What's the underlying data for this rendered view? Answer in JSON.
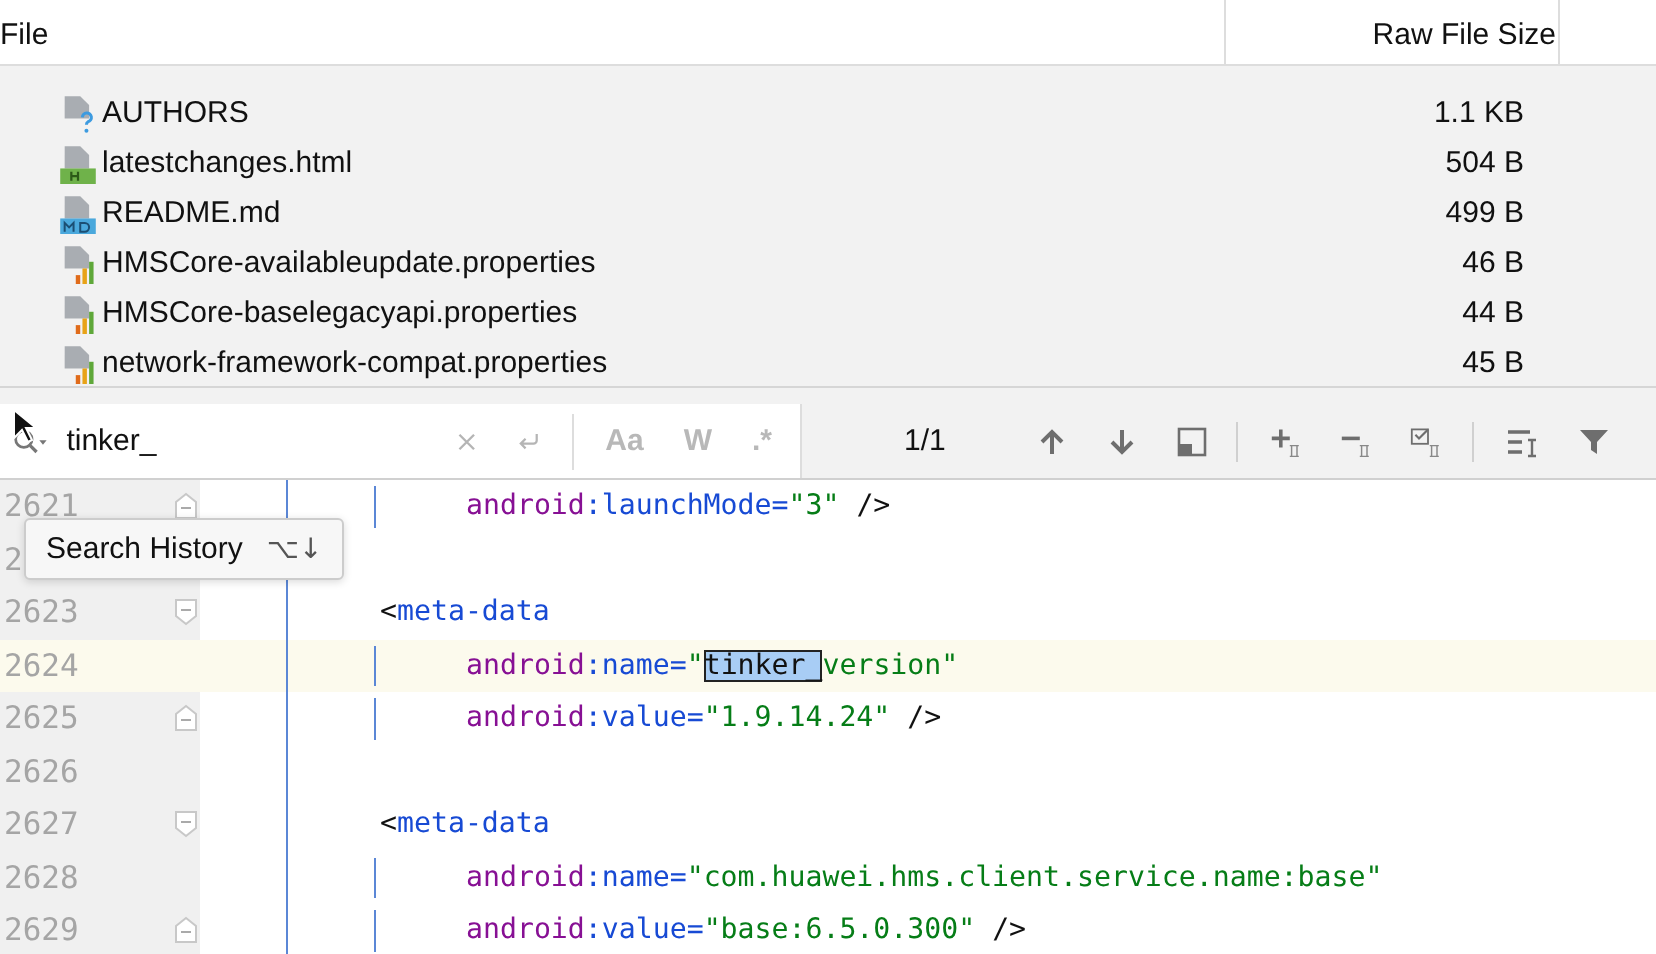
{
  "table": {
    "columns": [
      "File",
      "Raw File Size"
    ],
    "rows": [
      {
        "name": "AUTHORS",
        "size": "1.1 KB",
        "kind": "unknown"
      },
      {
        "name": "latestchanges.html",
        "size": "504 B",
        "kind": "html"
      },
      {
        "name": "README.md",
        "size": "499 B",
        "kind": "md"
      },
      {
        "name": "HMSCore-availableupdate.properties",
        "size": "46 B",
        "kind": "properties"
      },
      {
        "name": "HMSCore-baselegacyapi.properties",
        "size": "44 B",
        "kind": "properties"
      },
      {
        "name": "network-framework-compat.properties",
        "size": "45 B",
        "kind": "properties"
      }
    ]
  },
  "search": {
    "value": "tinker_",
    "options": [
      {
        "label": "Aa",
        "selected": false
      },
      {
        "label": "W",
        "selected": false
      },
      {
        "label": ".*",
        "selected": false
      }
    ],
    "match_count": "1/1"
  },
  "search_history_tooltip": {
    "label": "Search History",
    "shortcut": "⌥↓"
  },
  "editor": {
    "lines": [
      {
        "number": "2621",
        "fold_start": false,
        "fold_end": true,
        "current": false,
        "in_block": true,
        "tokens": [
          {
            "kind": "ns",
            "text": "android"
          },
          {
            "kind": "attr",
            "text": ":launchMode="
          },
          {
            "kind": "value",
            "text": "\"3\""
          },
          {
            "kind": "plain",
            "text": " />"
          }
        ]
      },
      {
        "number": "2",
        "current": false,
        "in_block": false
      },
      {
        "number": "2623",
        "fold_start": true,
        "fold_end": false,
        "current": false,
        "in_block": false,
        "tokens": [
          {
            "kind": "plain",
            "text": "<"
          },
          {
            "kind": "tag",
            "text": "meta-data"
          }
        ]
      },
      {
        "number": "2624",
        "fold_start": false,
        "fold_end": false,
        "current": true,
        "in_block": true,
        "tokens": [
          {
            "kind": "ns",
            "text": "android"
          },
          {
            "kind": "attr",
            "text": ":name="
          },
          {
            "kind": "value",
            "text": "\""
          },
          {
            "kind": "match",
            "text": "tinker_"
          },
          {
            "kind": "value",
            "text": "version\""
          }
        ]
      },
      {
        "number": "2625",
        "fold_start": false,
        "fold_end": true,
        "current": false,
        "in_block": true,
        "tokens": [
          {
            "kind": "ns",
            "text": "android"
          },
          {
            "kind": "attr",
            "text": ":value="
          },
          {
            "kind": "value",
            "text": "\"1.9.14.24\""
          },
          {
            "kind": "plain",
            "text": " />"
          }
        ]
      },
      {
        "number": "2626",
        "fold_start": false,
        "fold_end": false,
        "current": false,
        "in_block": false
      },
      {
        "number": "2627",
        "fold_start": true,
        "fold_end": false,
        "current": false,
        "in_block": false,
        "tokens": [
          {
            "kind": "plain",
            "text": "<"
          },
          {
            "kind": "tag",
            "text": "meta-data"
          }
        ]
      },
      {
        "number": "2628",
        "fold_start": false,
        "fold_end": false,
        "current": false,
        "in_block": true,
        "tokens": [
          {
            "kind": "ns",
            "text": "android"
          },
          {
            "kind": "attr",
            "text": ":name="
          },
          {
            "kind": "value",
            "text": "\"com.huawei.hms.client.service.name:base\""
          }
        ]
      },
      {
        "number": "2629",
        "fold_start": false,
        "fold_end": true,
        "current": false,
        "in_block": true,
        "tokens": [
          {
            "kind": "ns",
            "text": "android"
          },
          {
            "kind": "attr",
            "text": ":value="
          },
          {
            "kind": "value",
            "text": "\"base:6.5.0.300\""
          },
          {
            "kind": "plain",
            "text": " />"
          }
        ]
      }
    ]
  }
}
